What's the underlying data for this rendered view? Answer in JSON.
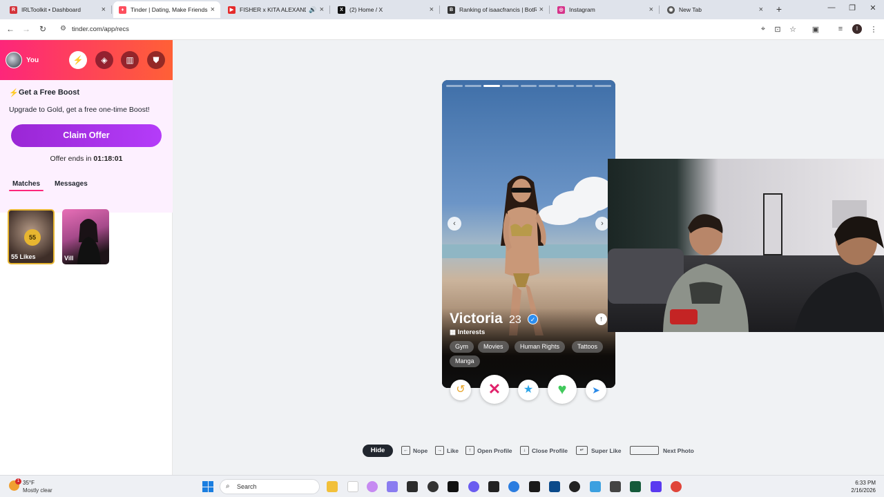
{
  "browser": {
    "tabs": [
      {
        "title": "IRLToolkit • Dashboard",
        "favicon": "irltoolkit-icon",
        "color": "#d4333a",
        "active": false
      },
      {
        "title": "Tinder | Dating, Make Friends &",
        "favicon": "tinder-icon",
        "color": "#fd4f5e",
        "active": true
      },
      {
        "title": "FISHER x KITA ALEXANDER",
        "favicon": "youtube-icon",
        "color": "#e52b2b",
        "active": false
      },
      {
        "title": "(2) Home / X",
        "favicon": "x-icon",
        "color": "#111111",
        "active": false
      },
      {
        "title": "Ranking of isaacfrancis | BotRix",
        "favicon": "botrix-icon",
        "color": "#333333",
        "active": false
      },
      {
        "title": "Instagram",
        "favicon": "instagram-icon",
        "color": "#d6338a",
        "active": false
      },
      {
        "title": "New Tab",
        "favicon": "chrome-icon",
        "color": "#555555",
        "active": false
      }
    ],
    "url": "tinder.com/app/recs",
    "profile_initial": "I"
  },
  "sidebar": {
    "user_label": "You",
    "boost": {
      "title": "Get a Free Boost",
      "description": "Upgrade to Gold, get a free one-time Boost!",
      "claim_label": "Claim Offer",
      "offer_prefix": "Offer ends in",
      "offer_timer": "01:18:01"
    },
    "tabs": {
      "matches": "Matches",
      "messages": "Messages"
    },
    "likes_count": "55",
    "likes_label": "55 Likes",
    "match_name": "Vill"
  },
  "profile": {
    "name": "Victoria",
    "age": "23",
    "interests_heading": "Interests",
    "interests": [
      "Gym",
      "Movies",
      "Human Rights",
      "Tattoos",
      "Manga"
    ],
    "photo_count": 9,
    "active_photo": 3
  },
  "shortcuts": {
    "hide": "Hide",
    "items": [
      {
        "key": "←",
        "label": "Nope"
      },
      {
        "key": "→",
        "label": "Like"
      },
      {
        "key": "↑",
        "label": "Open Profile"
      },
      {
        "key": "↓",
        "label": "Close Profile"
      },
      {
        "key": "↵",
        "label": "Super Like"
      },
      {
        "key": "",
        "label": "Next Photo"
      }
    ]
  },
  "taskbar": {
    "weather_temp": "35°F",
    "weather_desc": "Mostly clear",
    "weather_badge": "1",
    "search_placeholder": "Search",
    "time": "6:33 PM",
    "date": "2/16/2026"
  },
  "colors": {
    "tinder_gradient_start": "#fd267a",
    "tinder_gradient_end": "#ff6036",
    "gold": "#e8b630",
    "purple": "#a033ff"
  }
}
